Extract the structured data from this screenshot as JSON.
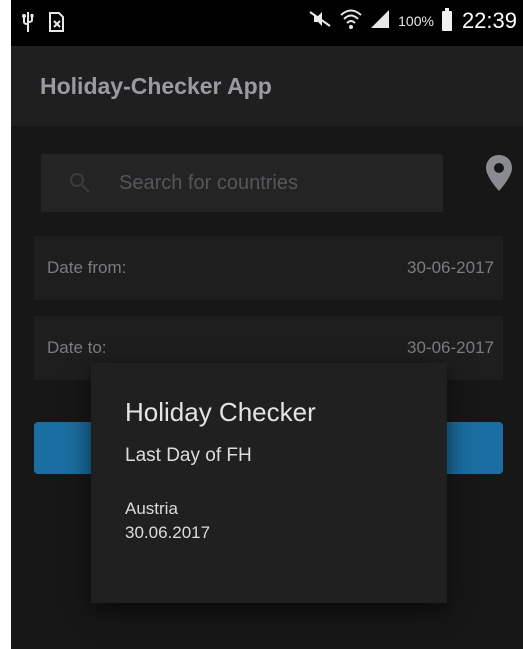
{
  "status_bar": {
    "battery_percent": "100%",
    "time": "22:39"
  },
  "app_bar": {
    "title": "Holiday-Checker App"
  },
  "search": {
    "placeholder": "Search for countries"
  },
  "date_from": {
    "label": "Date from:",
    "value": "30-06-2017"
  },
  "date_to": {
    "label": "Date to:",
    "value": "30-06-2017"
  },
  "dialog": {
    "title": "Holiday Checker",
    "subtitle": "Last Day of FH",
    "country": "Austria",
    "date": "30.06.2017"
  },
  "colors": {
    "accent": "#1a6ea1",
    "background": "#171717",
    "dialog": "#202020"
  }
}
